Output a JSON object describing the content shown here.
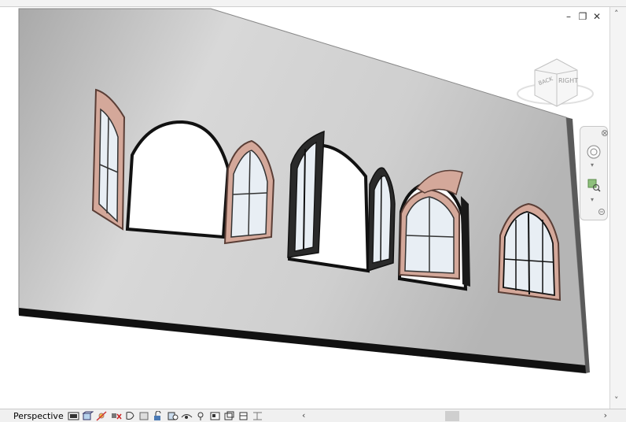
{
  "view": {
    "mode_label": "Perspective",
    "viewcube_face": "RIGHT",
    "viewcube_face_secondary": "BACK"
  },
  "window_controls": {
    "minimize": "–",
    "restore": "❐",
    "close": "✕"
  },
  "colors": {
    "wall_light": "#cfcfcf",
    "wall_dark": "#8e8e8e",
    "frame_wood": "#d4a89a",
    "frame_dark": "#2a2a2a",
    "glass": "#e8eef4"
  },
  "icons": [
    "visual-style-icon",
    "detail-level-icon",
    "sun-path-icon",
    "shadows-icon",
    "crop-view-icon",
    "show-crop-icon",
    "unlock-view-icon",
    "temporary-hide-icon",
    "reveal-hidden-icon",
    "worksharing-icon",
    "analytical-model-icon",
    "highlight-displacement-icon",
    "reveal-constraints-icon",
    "render-icon"
  ]
}
